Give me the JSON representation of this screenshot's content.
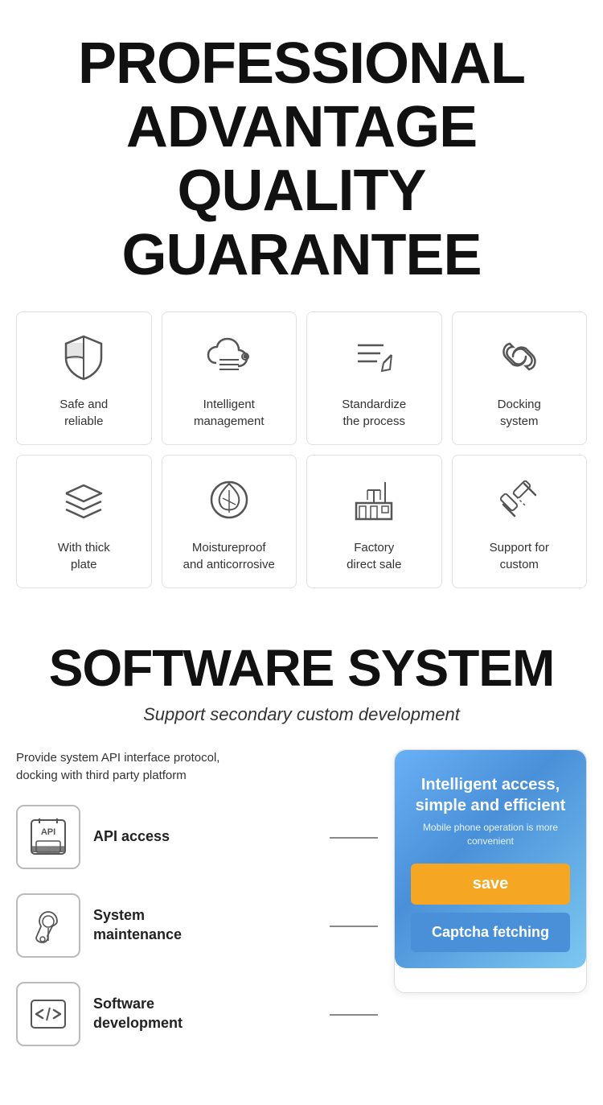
{
  "header": {
    "line1": "PROFESSIONAL",
    "line2": "ADVANTAGE",
    "line3": "QUALITY GUARANTEE"
  },
  "grid": {
    "row1": [
      {
        "id": "safe",
        "label": "Safe and\nreliable",
        "icon": "shield"
      },
      {
        "id": "intelligent",
        "label": "Intelligent\nmanagement",
        "icon": "cloud-settings"
      },
      {
        "id": "standardize",
        "label": "Standardize\nthe process",
        "icon": "edit-lines"
      },
      {
        "id": "docking",
        "label": "Docking\nsystem",
        "icon": "link"
      }
    ],
    "row2": [
      {
        "id": "thick",
        "label": "With thick\nplate",
        "icon": "layers"
      },
      {
        "id": "moistureproof",
        "label": "Moistureproof\nand anticorrosive",
        "icon": "leaf-drop"
      },
      {
        "id": "factory",
        "label": "Factory\ndirect sale",
        "icon": "factory"
      },
      {
        "id": "custom",
        "label": "Support for\ncustom",
        "icon": "tools"
      }
    ]
  },
  "software": {
    "title": "SOFTWARE SYSTEM",
    "subtitle": "Support secondary custom development",
    "provide_text": "Provide system API interface protocol,\ndocking with third party platform",
    "features": [
      {
        "id": "api",
        "icon": "api",
        "label": "API access"
      },
      {
        "id": "maintenance",
        "icon": "wrench-drop",
        "label": "System\nmaintenance"
      },
      {
        "id": "dev",
        "icon": "code",
        "label": "Software\ndevelopment"
      }
    ],
    "panel": {
      "title": "Intelligent access,\nsimple and efficient",
      "subtitle": "Mobile phone operation is more\nconvenient",
      "save_btn": "save",
      "captcha_btn": "Captcha fetching"
    }
  }
}
